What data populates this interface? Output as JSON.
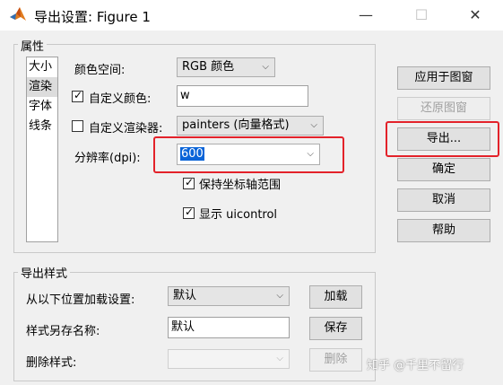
{
  "window": {
    "title": "导出设置: Figure 1",
    "controls": {
      "minimize": "—",
      "maximize": "☐",
      "close": "✕"
    }
  },
  "properties": {
    "group_label": "属性",
    "list_items": [
      "大小",
      "渲染",
      "字体",
      "线条"
    ],
    "selected_item": "渲染",
    "color_space_label": "颜色空间:",
    "color_space_value": "RGB 颜色",
    "custom_color_label": "自定义颜色:",
    "custom_color_checked": true,
    "custom_color_value": "w",
    "custom_renderer_label": "自定义渲染器:",
    "custom_renderer_checked": false,
    "renderer_value": "painters (向量格式)",
    "resolution_label": "分辨率(dpi):",
    "resolution_value": "600",
    "keep_axes_label": "保持坐标轴范围",
    "keep_axes_checked": true,
    "show_uicontrol_label": "显示 uicontrol",
    "show_uicontrol_checked": true
  },
  "actions": {
    "apply": "应用于图窗",
    "restore": "还原图窗",
    "export": "导出...",
    "ok": "确定",
    "cancel": "取消",
    "help": "帮助"
  },
  "export_style": {
    "group_label": "导出样式",
    "load_label": "从以下位置加载设置:",
    "load_value": "默认",
    "load_button": "加载",
    "save_label": "样式另存名称:",
    "save_value": "默认",
    "save_button": "保存",
    "delete_label": "删除样式:",
    "delete_value": "",
    "delete_button": "删除"
  },
  "watermark": "知乎 @千里不留行",
  "colors": {
    "highlight": "#e3222a",
    "selection": "#0a64d8"
  }
}
